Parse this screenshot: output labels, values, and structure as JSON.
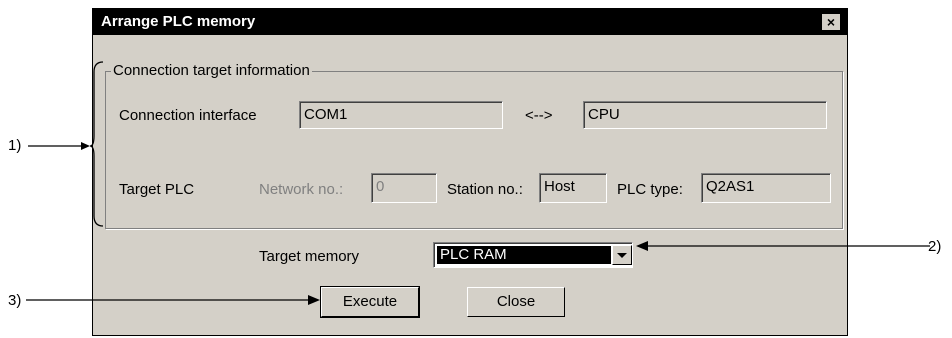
{
  "dialog": {
    "title": "Arrange PLC memory",
    "close_glyph": "×"
  },
  "group": {
    "legend": "Connection target information",
    "connection_interface_label": "Connection interface",
    "connection_interface_value": "COM1",
    "arrow_text": "<-->",
    "cpu_value": "CPU",
    "target_plc_label": "Target PLC",
    "network_no_label": "Network no.:",
    "network_no_value": "0",
    "station_no_label": "Station no.:",
    "station_no_value": "Host",
    "plc_type_label": "PLC type:",
    "plc_type_value": "Q2AS1"
  },
  "target_memory": {
    "label": "Target memory",
    "selected": "PLC RAM"
  },
  "buttons": {
    "execute": "Execute",
    "close": "Close"
  },
  "annotations": {
    "a1": "1)",
    "a2": "2)",
    "a3": "3)"
  }
}
